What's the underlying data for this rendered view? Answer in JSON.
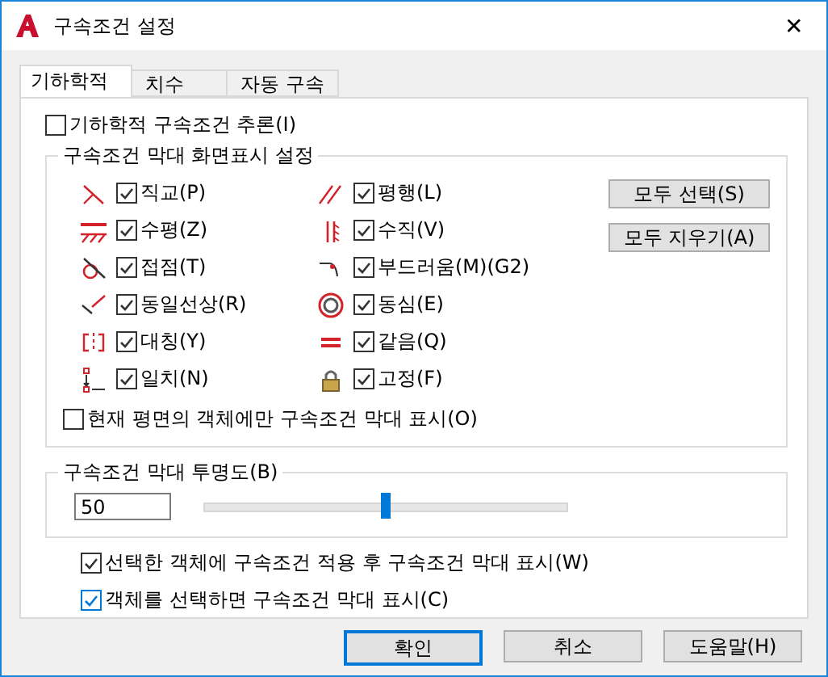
{
  "window": {
    "title": "구속조건 설정",
    "close": "✕"
  },
  "tabs": [
    {
      "label": "기하학적",
      "selected": true
    },
    {
      "label": "치수",
      "selected": false
    },
    {
      "label": "자동 구속",
      "selected": false
    }
  ],
  "infer": {
    "label": "기하학적 구속조건 추론(I)",
    "checked": false
  },
  "display_group": {
    "title": "구속조건 막대 화면표시 설정",
    "constraints": [
      {
        "label": "직교(P)",
        "checked": true
      },
      {
        "label": "평행(L)",
        "checked": true
      },
      {
        "label": "수평(Z)",
        "checked": true
      },
      {
        "label": "수직(V)",
        "checked": true
      },
      {
        "label": "접점(T)",
        "checked": true
      },
      {
        "label": "부드러움(M)(G2)",
        "checked": true
      },
      {
        "label": "동일선상(R)",
        "checked": true
      },
      {
        "label": "동심(E)",
        "checked": true
      },
      {
        "label": "대칭(Y)",
        "checked": true
      },
      {
        "label": "같음(Q)",
        "checked": true
      },
      {
        "label": "일치(N)",
        "checked": true
      },
      {
        "label": "고정(F)",
        "checked": true
      }
    ],
    "buttons": [
      "모두 선택(S)",
      "모두 지우기(A)"
    ],
    "current_plane": {
      "label": "현재 평면의 객체에만 구속조건 막대 표시(O)",
      "checked": false
    }
  },
  "transparency": {
    "title": "구속조건 막대 투명도(B)",
    "value": "50",
    "level": 0.5
  },
  "options": [
    {
      "label": "선택한 객체에 구속조건 적용 후 구속조건 막대 표시(W)",
      "checked": true
    },
    {
      "label": "객체를 선택하면 구속조건 막대 표시(C)",
      "checked": true
    }
  ],
  "footer": [
    {
      "label": "확인",
      "default": true
    },
    {
      "label": "취소",
      "default": false
    },
    {
      "label": "도움말(H)",
      "default": false
    }
  ]
}
